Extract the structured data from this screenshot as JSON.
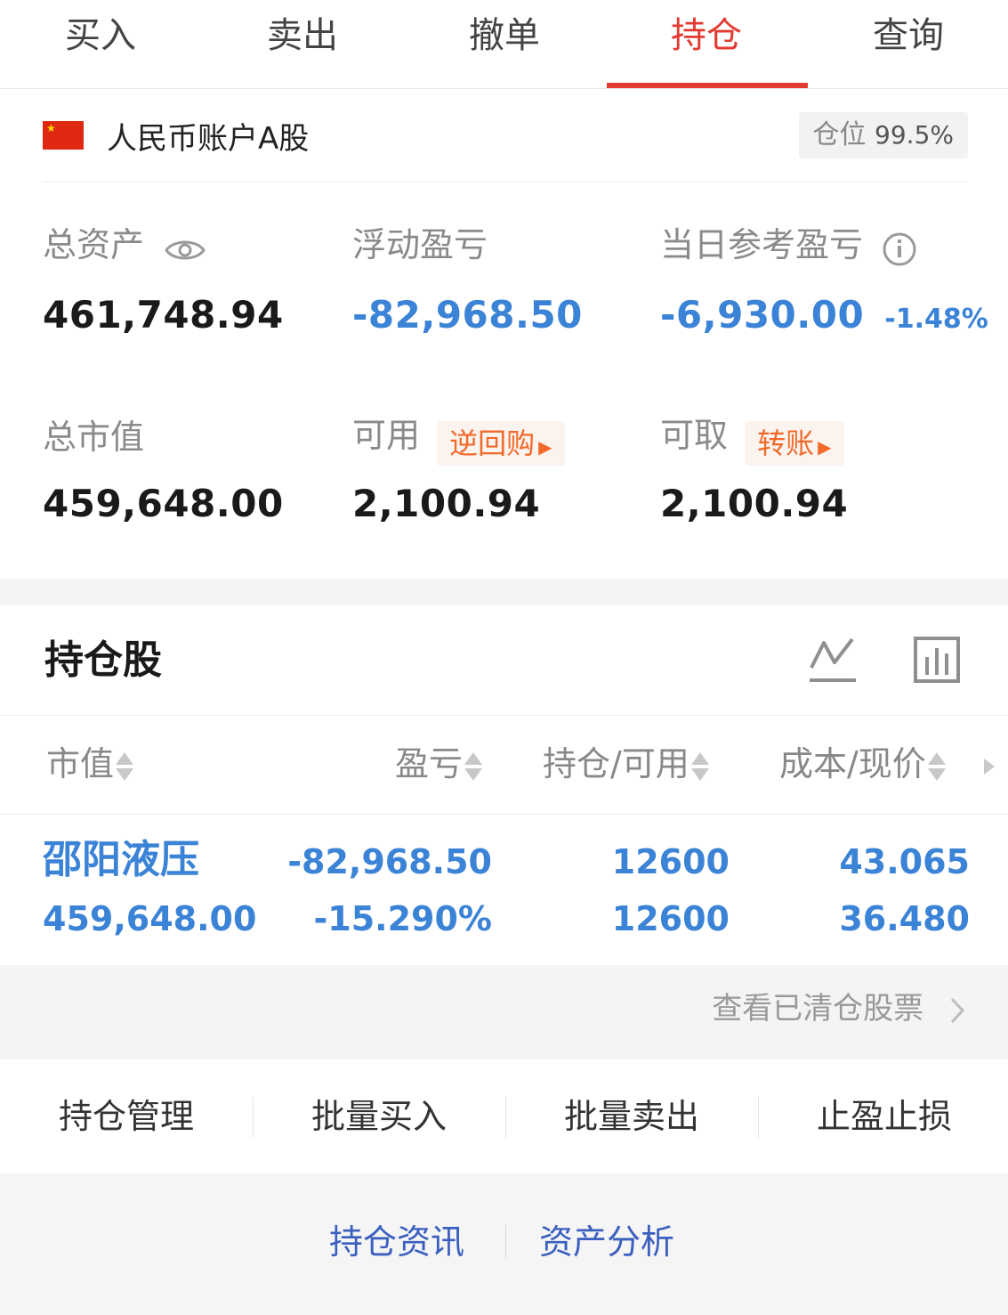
{
  "tabs": [
    "买入",
    "卖出",
    "撤单",
    "持仓",
    "查询"
  ],
  "active_tab_index": 3,
  "account": {
    "name": "人民币账户A股",
    "position_label": "仓位",
    "position_value": "99.5%"
  },
  "summary": {
    "total_assets_label": "总资产",
    "total_assets": "461,748.94",
    "floating_pl_label": "浮动盈亏",
    "floating_pl": "-82,968.50",
    "daily_pl_label": "当日参考盈亏",
    "daily_pl": "-6,930.00",
    "daily_pl_pct": "-1.48%",
    "market_value_label": "总市值",
    "market_value": "459,648.00",
    "available_label": "可用",
    "reverse_repo_btn": "逆回购",
    "available": "2,100.94",
    "withdrawable_label": "可取",
    "transfer_btn": "转账",
    "withdrawable": "2,100.94"
  },
  "holdings": {
    "title": "持仓股",
    "columns": [
      "市值",
      "盈亏",
      "持仓/可用",
      "成本/现价"
    ],
    "rows": [
      {
        "name": "邵阳液压",
        "market_value": "459,648.00",
        "pl": "-82,968.50",
        "pl_pct": "-15.290%",
        "position": "12600",
        "available": "12600",
        "cost": "43.065",
        "price": "36.480"
      }
    ],
    "view_cleared": "查看已清仓股票"
  },
  "actions": [
    "持仓管理",
    "批量买入",
    "批量卖出",
    "止盈止损"
  ],
  "bottom_links": [
    "持仓资讯",
    "资产分析"
  ],
  "colors": {
    "accent_red": "#e23b32",
    "value_blue": "#3b83d6",
    "tag_orange": "#f26a2a",
    "link_blue": "#3b5fbf"
  },
  "icons": {
    "eye": "eye-icon",
    "info": "info-icon",
    "line_chart": "line-chart-icon",
    "bar_chart": "bar-chart-icon"
  }
}
